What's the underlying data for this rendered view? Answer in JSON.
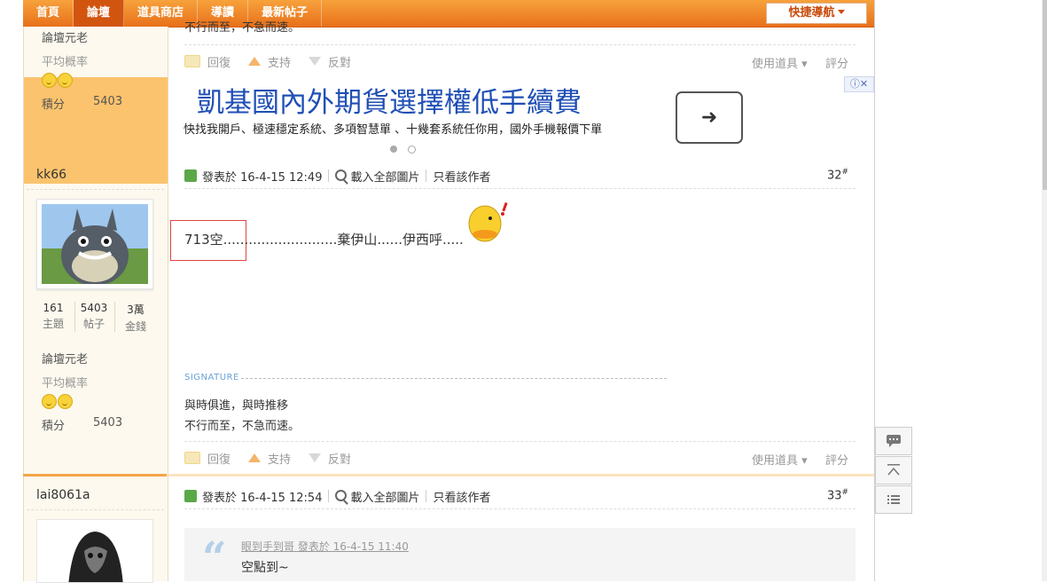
{
  "nav": {
    "items": [
      "首頁",
      "論壇",
      "道具商店",
      "導讀",
      "最新帖子"
    ],
    "active_index": 1,
    "quick_nav": "快捷導航"
  },
  "prev_post": {
    "user_title": "論壇元老",
    "rating_label": "平均概率",
    "points_label": "積分",
    "points_value": "5403",
    "sig_tail": "不行而至，不急而速。"
  },
  "actions": {
    "reply": "回復",
    "support": "支持",
    "oppose": "反對",
    "use_item": "使用道具",
    "rate": "評分"
  },
  "ad": {
    "title": "凱基國內外期貨選擇權低手續費",
    "subtitle": "快找我開戶、極速穩定系統、多項智慧單 、十幾套系統任你用，國外手機報價下單",
    "arrow": "➜",
    "info": "ⓘ✕"
  },
  "post32": {
    "username": "kk66",
    "stats": [
      {
        "value": "161",
        "label": "主題"
      },
      {
        "value": "5403",
        "label": "帖子"
      },
      {
        "value": "3萬",
        "label": "金錢"
      }
    ],
    "user_title": "論壇元老",
    "rating_label": "平均概率",
    "points_label": "積分",
    "points_value": "5403",
    "posted": "發表於 16-4-15 12:49",
    "load_images": "載入全部圖片",
    "only_author": "只看該作者",
    "floor": "32",
    "content": "713空...........................棄伊山......伊西呼.....",
    "signature_label": "SIGNATURE",
    "signature_lines": [
      "與時俱進，與時推移",
      "不行而至，不急而速。"
    ]
  },
  "post33": {
    "username": "lai8061a",
    "posted": "發表於 16-4-15 12:54",
    "load_images": "載入全部圖片",
    "only_author": "只看該作者",
    "floor": "33",
    "quote_meta": "眼到手到哥 發表於 16-4-15 11:40",
    "quote_body": "空點到~"
  }
}
